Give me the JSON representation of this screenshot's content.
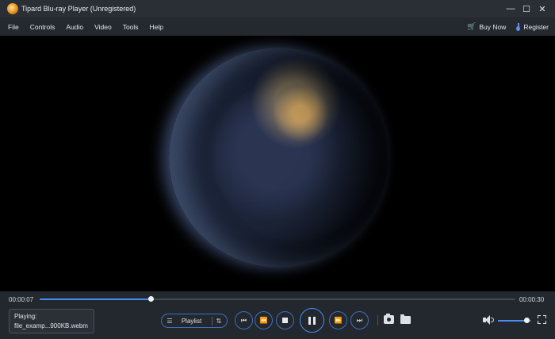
{
  "window": {
    "title": "Tipard Blu-ray Player (Unregistered)",
    "controls": {
      "minimize": "—",
      "maximize": "☐",
      "close": "✕"
    }
  },
  "menu": {
    "items": [
      "File",
      "Controls",
      "Audio",
      "Video",
      "Tools",
      "Help"
    ],
    "buy_now": "Buy Now",
    "register": "Register"
  },
  "playback": {
    "current_time": "00:00:07",
    "total_time": "00:00:30",
    "progress_fraction": 0.233,
    "status_label": "Playing:",
    "file_name": "file_examp...900KB.webm",
    "playlist_label": "Playlist",
    "volume_fraction": 0.85
  },
  "icons": {
    "list": "☰",
    "sort": "⇅",
    "prev": "⏮",
    "rewind": "⏪",
    "forward": "⏩",
    "next": "⏭",
    "cart": "🛒"
  },
  "colors": {
    "accent": "#4a8cf5",
    "titlebar": "#2a2e35",
    "controls_bg": "#23272e",
    "brand_orange": "#e7a53a"
  }
}
